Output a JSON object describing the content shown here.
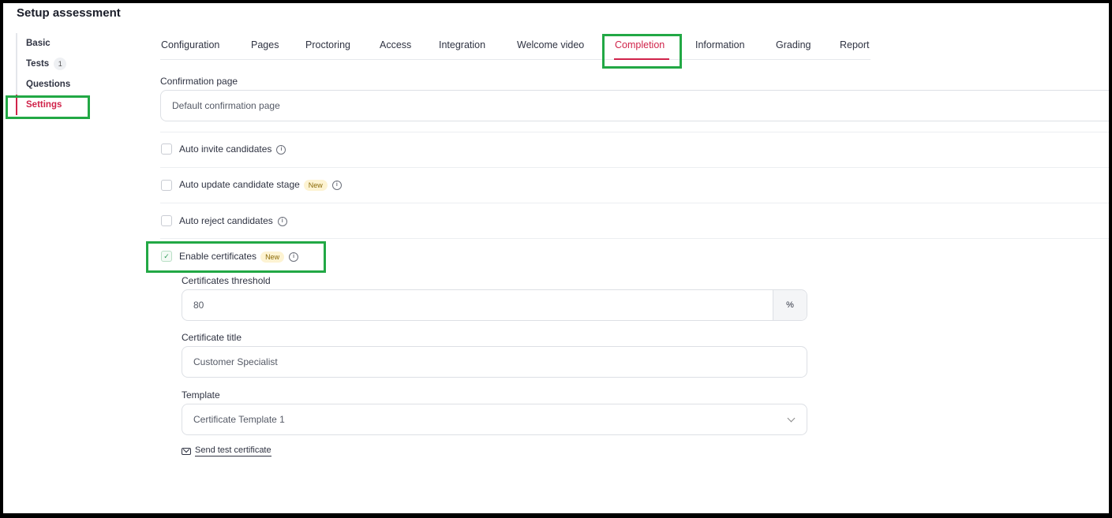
{
  "page": {
    "title": "Setup assessment"
  },
  "sidebar": {
    "items": [
      {
        "label": "Basic"
      },
      {
        "label": "Tests",
        "count": "1"
      },
      {
        "label": "Questions"
      },
      {
        "label": "Settings",
        "active": true
      }
    ]
  },
  "tabs": [
    {
      "label": "Configuration"
    },
    {
      "label": "Pages"
    },
    {
      "label": "Proctoring"
    },
    {
      "label": "Access"
    },
    {
      "label": "Integration"
    },
    {
      "label": "Welcome video"
    },
    {
      "label": "Completion",
      "active": true
    },
    {
      "label": "Information"
    },
    {
      "label": "Grading"
    },
    {
      "label": "Report"
    }
  ],
  "form": {
    "confirmation_label": "Confirmation page",
    "confirmation_value": "Default confirmation page",
    "auto_invite": {
      "label": "Auto invite candidates",
      "checked": false
    },
    "auto_update": {
      "label": "Auto update candidate stage",
      "badge": "New",
      "checked": false
    },
    "auto_reject": {
      "label": "Auto reject candidates",
      "checked": false
    },
    "enable_certificates": {
      "label": "Enable certificates",
      "badge": "New",
      "checked": true
    },
    "threshold_label": "Certificates threshold",
    "threshold_value": "80",
    "threshold_suffix": "%",
    "cert_title_label": "Certificate title",
    "cert_title_value": "Customer Specialist",
    "template_label": "Template",
    "template_value": "Certificate Template 1",
    "send_test_label": "Send test certificate"
  },
  "colors": {
    "accent": "#d0234a",
    "highlight": "#22a845",
    "badge_bg": "#fdf3d2"
  },
  "icons": {
    "info": "info-icon",
    "checkbox_check": "check-icon",
    "dropdown": "chevron-down-icon",
    "mail": "mail-icon"
  }
}
